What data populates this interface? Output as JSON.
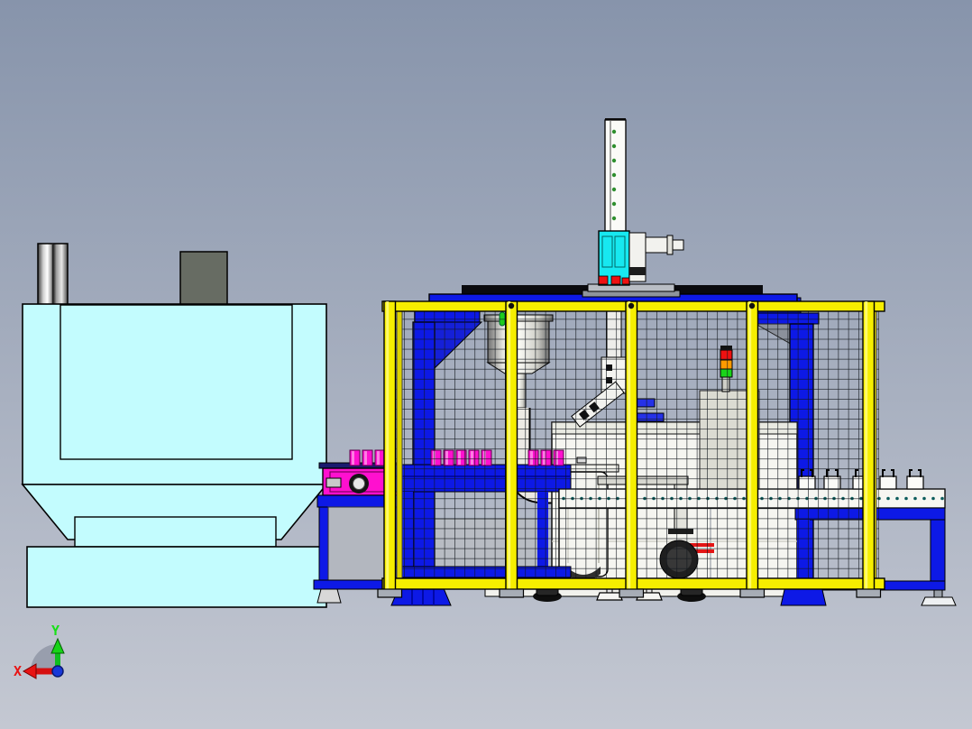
{
  "viewport": {
    "type": "cad-3d-side-view",
    "background_top": "#8794ab",
    "background_bottom": "#c4c8d2"
  },
  "axis_triad": {
    "x_label": "X",
    "y_label": "Y",
    "x_color": "#e81414",
    "y_color": "#17d417",
    "origin_dot_color": "#1838d8"
  },
  "palette": {
    "frame_blue": "#0d19e6",
    "frame_blue_dark": "#0008a8",
    "fence_yellow": "#f6ee00",
    "fence_yellow_back": "#ddd200",
    "hopper_cyan": "#c3fcfe",
    "actuator_cyan": "#17e8f0",
    "product_magenta": "#ff10cf",
    "product_magenta_light": "#ff8fe6",
    "machine_white": "#f5f5f0",
    "silver": "#e8e8e2",
    "steel_gray": "#b3b7bf",
    "cabinet_gray": "#dbdbd2",
    "control_box_gray": "#676c63",
    "mesh_line": "#11161c",
    "stack_light_red": "#ee1111",
    "stack_light_amber": "#ff9a00",
    "stack_light_green": "#19d419",
    "pump_dark": "#1f1f1f"
  },
  "components": {
    "left_assembly": "hopper-washer-unit",
    "chimney": "exhaust-stack",
    "control_box": "electrical-box",
    "enclosure": "safety-fence-enclosure",
    "gantry": "vertical-gantry-axis",
    "feeder": "bowl-feeder",
    "vessel": "process-tank",
    "pipe": "elbow-pipe",
    "pump": "pump-motor",
    "stack_light": "signal-tower",
    "conveyor_left": "infeed-conveyor",
    "conveyor_right": "outfeed-conveyor",
    "robot": "gripper-end-effector"
  }
}
